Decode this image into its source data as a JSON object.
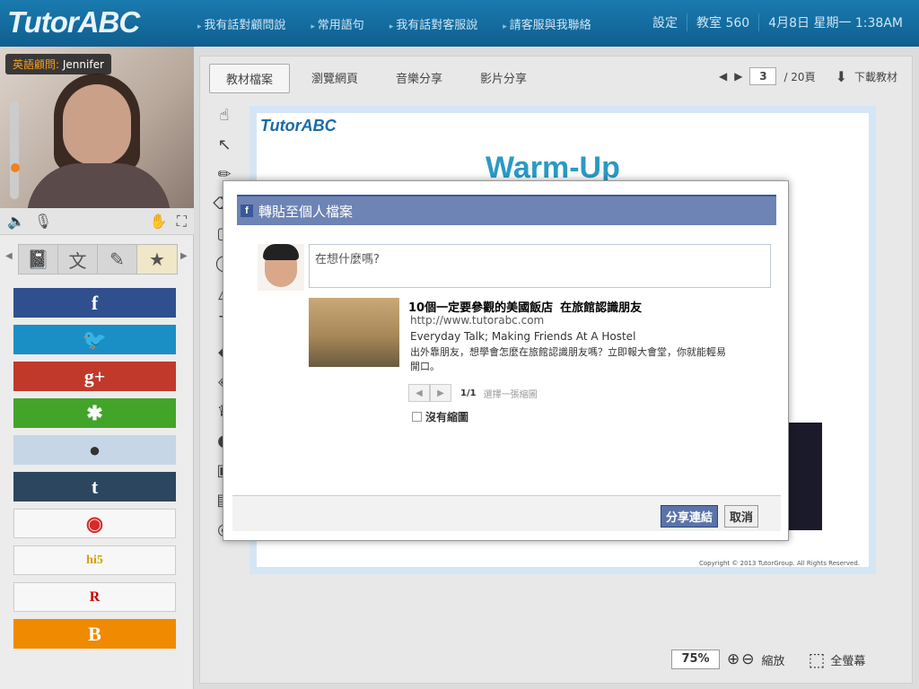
{
  "header": {
    "logo": "TutorABC",
    "nav": [
      "我有話對顧問說",
      "常用語句",
      "我有話對客服說",
      "請客服與我聯絡"
    ],
    "settings": "設定",
    "classroom": "教室 560",
    "datetime": "4月8日 星期一 1:38AM"
  },
  "left": {
    "tutor_label": "英語顧問:",
    "tutor_name": "Jennifer",
    "share_buttons": [
      {
        "name": "facebook",
        "glyph": "f",
        "color": "#2f4f8f"
      },
      {
        "name": "twitter",
        "glyph": "🐦",
        "color": "#1a8fc6"
      },
      {
        "name": "google-plus",
        "glyph": "g+",
        "color": "#c0392b"
      },
      {
        "name": "plurk",
        "glyph": "✱",
        "color": "#43a42a"
      },
      {
        "name": "reddit",
        "glyph": "●",
        "color": "#c6d6e6"
      },
      {
        "name": "tumblr",
        "glyph": "t",
        "color": "#2c4660"
      },
      {
        "name": "weibo",
        "glyph": "◉",
        "color": "#f7f7f7"
      },
      {
        "name": "hi5",
        "glyph": "hi5",
        "color": "#f7f7f7"
      },
      {
        "name": "renren",
        "glyph": "R",
        "color": "#f7f7f7"
      },
      {
        "name": "blogger",
        "glyph": "B",
        "color": "#f08a00"
      }
    ]
  },
  "main": {
    "tabs": [
      "教材檔案",
      "瀏覽網頁",
      "音樂分享",
      "影片分享"
    ],
    "page_current": "3",
    "page_total": "/ 20頁",
    "download": "下載教材",
    "slide_logo": "TutorABC",
    "slide_title": "Warm-Up",
    "slide_copyright": "Copyright © 2013 TutorGroup. All Rights Reserved.",
    "zoom": "75%",
    "zoom_label": "縮放",
    "fullscreen": "全螢幕"
  },
  "dialog": {
    "title": "轉貼至個人檔案",
    "placeholder": "在想什麼嗎?",
    "link_title": "10個一定要參觀的美國飯店",
    "link_title2": "在旅館認識朋友",
    "link_url": "http://www.tutorabc.com",
    "link_subtitle": "Everyday Talk; Making Friends At A Hostel",
    "link_desc": "出外靠朋友，想學會怎麼在旅館認識朋友嗎？立即報大會堂，你就能輕易開口。",
    "thumb_count": "1/1",
    "thumb_label": "選擇一張縮圖",
    "no_thumb": "沒有縮圖",
    "share": "分享連結",
    "cancel": "取消"
  }
}
